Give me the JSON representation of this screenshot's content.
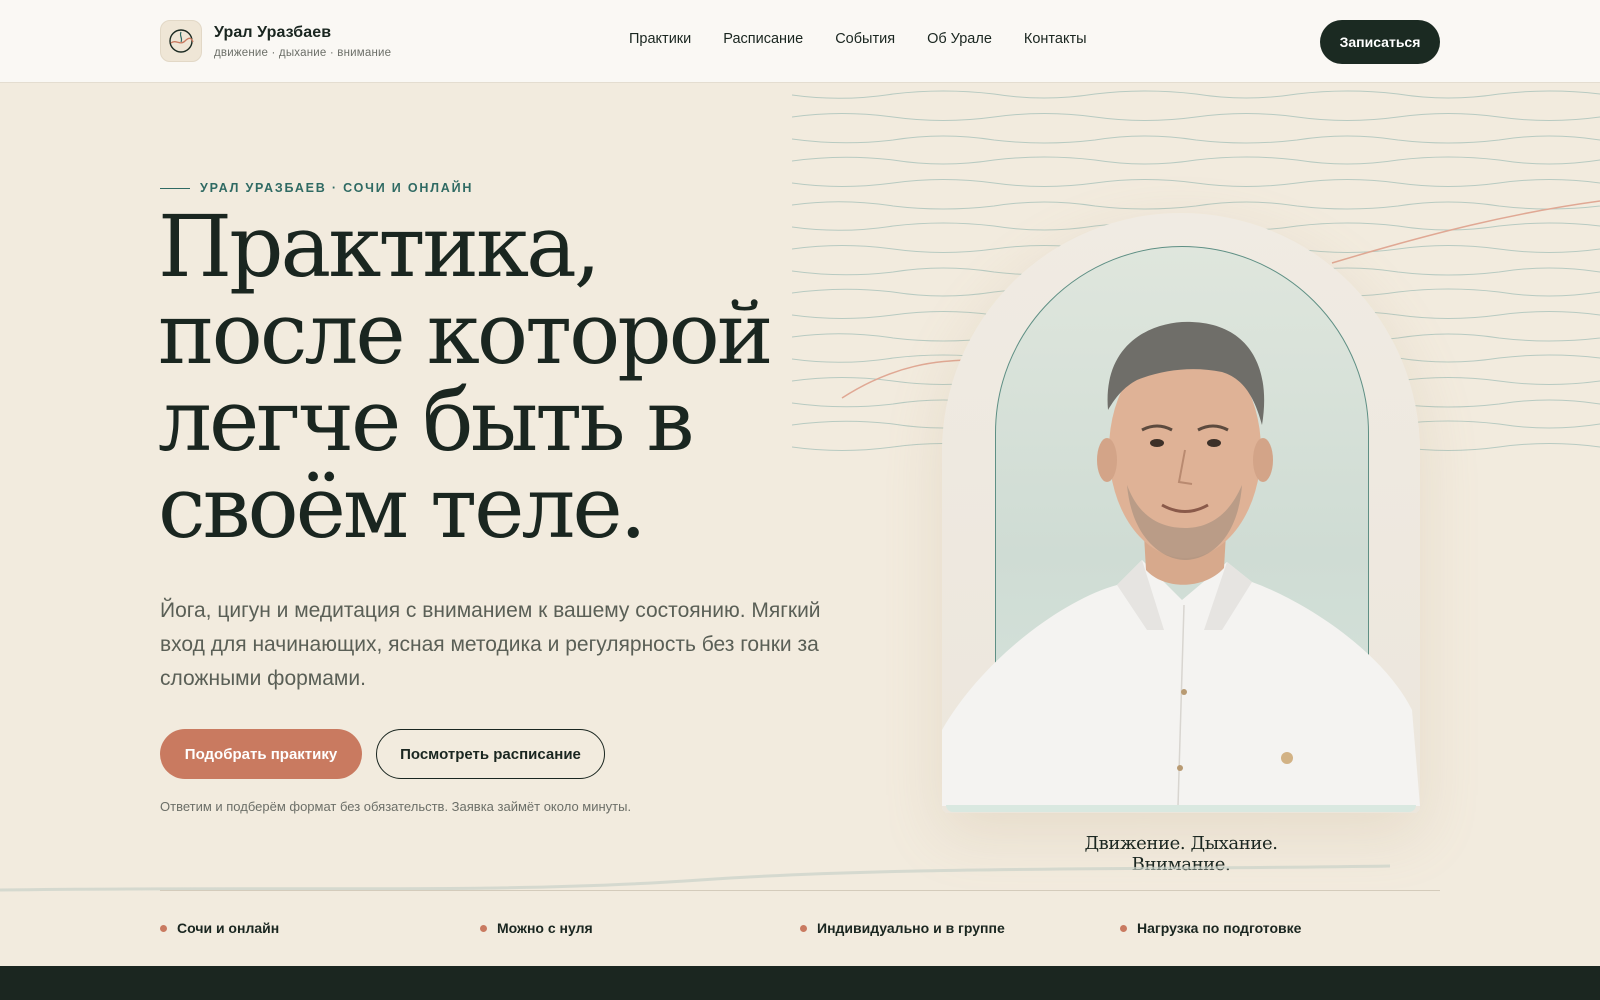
{
  "header": {
    "brand_name": "Урал Уразбаев",
    "brand_tagline": "движение · дыхание · внимание",
    "logo_icon": "breath-circle-icon",
    "nav": [
      {
        "label": "Практики"
      },
      {
        "label": "Расписание"
      },
      {
        "label": "События"
      },
      {
        "label": "Об Урале"
      },
      {
        "label": "Контакты"
      }
    ],
    "cta_label": "Записаться"
  },
  "hero": {
    "eyebrow": "УРАЛ УРАЗБАЕВ · СОЧИ И ОНЛАЙН",
    "headline_lines": [
      "Практика,",
      "после которой",
      "легче быть в",
      "своём теле."
    ],
    "lead": "Йога, цигун и медитация с вниманием к вашему состоянию. Мягкий вход для начинающих, ясная методика и регулярность без гонки за сложными формами.",
    "primary_button": "Подобрать практику",
    "secondary_button": "Посмотреть расписание",
    "note": "Ответим и подберём формат без обязательств. Заявка займёт около минуты.",
    "image_caption": "Движение. Дыхание. Внимание."
  },
  "features": [
    {
      "label": "Сочи и онлайн"
    },
    {
      "label": "Можно с нуля"
    },
    {
      "label": "Индивидуально и в группе"
    },
    {
      "label": "Нагрузка по подготовке"
    }
  ],
  "colors": {
    "background": "#f2ebde",
    "header_bg": "#faf8f4",
    "dark": "#1b2a22",
    "accent": "#c97a60",
    "teal": "#2f6a63"
  }
}
